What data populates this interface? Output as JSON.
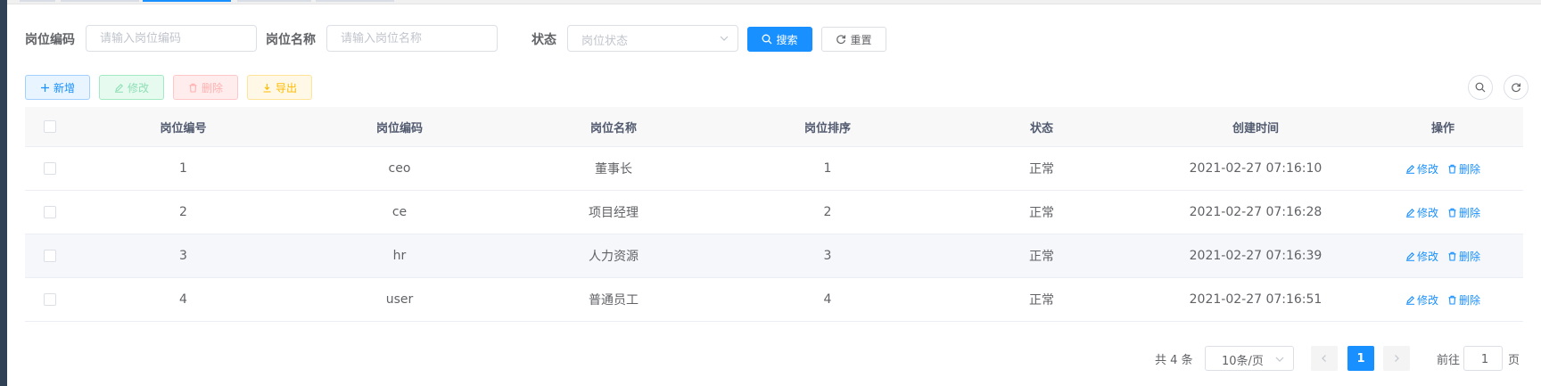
{
  "colors": {
    "primary": "#1890ff",
    "success_light": "#e7faf0",
    "danger_light": "#ffeded",
    "warning_light": "#fff8e6"
  },
  "search": {
    "post_code_label": "岗位编码",
    "post_code_placeholder": "请输入岗位编码",
    "post_name_label": "岗位名称",
    "post_name_placeholder": "请输入岗位名称",
    "status_label": "状态",
    "status_placeholder": "岗位状态",
    "search_button": "搜索",
    "reset_button": "重置"
  },
  "toolbar": {
    "add_label": "新增",
    "edit_label": "修改",
    "delete_label": "删除",
    "export_label": "导出",
    "icons": [
      "plus-icon",
      "edit-icon",
      "delete-icon",
      "download-icon",
      "search-icon",
      "refresh-icon"
    ]
  },
  "table": {
    "headers": [
      "岗位编号",
      "岗位编码",
      "岗位名称",
      "岗位排序",
      "状态",
      "创建时间",
      "操作"
    ],
    "rows": [
      {
        "id": "1",
        "code": "ceo",
        "name": "董事长",
        "sort": "1",
        "status": "正常",
        "created": "2021-02-27 07:16:10"
      },
      {
        "id": "2",
        "code": "ce",
        "name": "项目经理",
        "sort": "2",
        "status": "正常",
        "created": "2021-02-27 07:16:28"
      },
      {
        "id": "3",
        "code": "hr",
        "name": "人力资源",
        "sort": "3",
        "status": "正常",
        "created": "2021-02-27 07:16:39"
      },
      {
        "id": "4",
        "code": "user",
        "name": "普通员工",
        "sort": "4",
        "status": "正常",
        "created": "2021-02-27 07:16:51"
      }
    ],
    "row_edit": "修改",
    "row_delete": "删除"
  },
  "pagination": {
    "total": "共 4 条",
    "page_size": "10条/页",
    "current_page": "1",
    "goto_prefix": "前往",
    "goto_value": "1",
    "goto_suffix": "页"
  }
}
